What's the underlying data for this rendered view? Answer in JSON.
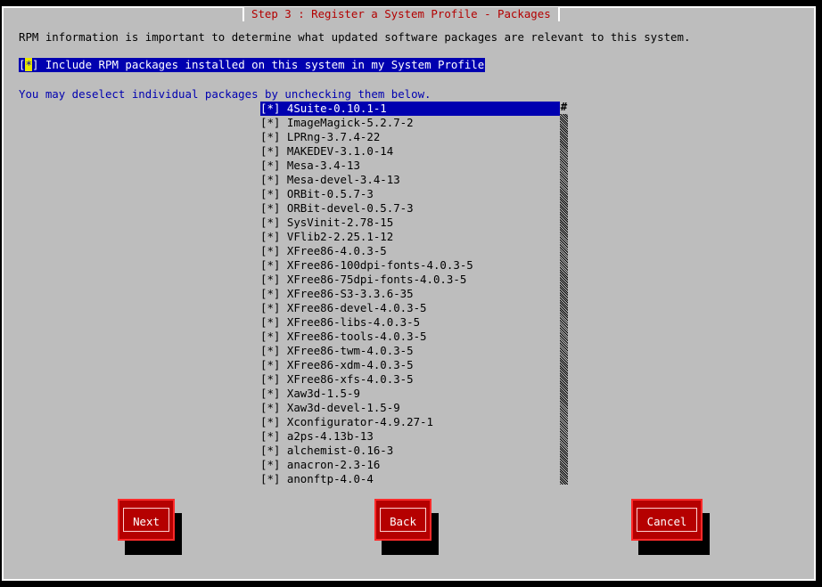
{
  "title": "Step 3 : Register a System Profile - Packages",
  "intro": "RPM information is important to determine what updated software packages are relevant to this system.",
  "include_checkbox": {
    "mark": "*",
    "label": "Include RPM packages installed on this system in my System Profile"
  },
  "hint": "You may deselect individual packages by unchecking them below.",
  "scrollbar_thumb": "#",
  "packages": [
    {
      "check": "[*]",
      "name": "4Suite-0.10.1-1"
    },
    {
      "check": "[*]",
      "name": "ImageMagick-5.2.7-2"
    },
    {
      "check": "[*]",
      "name": "LPRng-3.7.4-22"
    },
    {
      "check": "[*]",
      "name": "MAKEDEV-3.1.0-14"
    },
    {
      "check": "[*]",
      "name": "Mesa-3.4-13"
    },
    {
      "check": "[*]",
      "name": "Mesa-devel-3.4-13"
    },
    {
      "check": "[*]",
      "name": "ORBit-0.5.7-3"
    },
    {
      "check": "[*]",
      "name": "ORBit-devel-0.5.7-3"
    },
    {
      "check": "[*]",
      "name": "SysVinit-2.78-15"
    },
    {
      "check": "[*]",
      "name": "VFlib2-2.25.1-12"
    },
    {
      "check": "[*]",
      "name": "XFree86-4.0.3-5"
    },
    {
      "check": "[*]",
      "name": "XFree86-100dpi-fonts-4.0.3-5"
    },
    {
      "check": "[*]",
      "name": "XFree86-75dpi-fonts-4.0.3-5"
    },
    {
      "check": "[*]",
      "name": "XFree86-S3-3.3.6-35"
    },
    {
      "check": "[*]",
      "name": "XFree86-devel-4.0.3-5"
    },
    {
      "check": "[*]",
      "name": "XFree86-libs-4.0.3-5"
    },
    {
      "check": "[*]",
      "name": "XFree86-tools-4.0.3-5"
    },
    {
      "check": "[*]",
      "name": "XFree86-twm-4.0.3-5"
    },
    {
      "check": "[*]",
      "name": "XFree86-xdm-4.0.3-5"
    },
    {
      "check": "[*]",
      "name": "XFree86-xfs-4.0.3-5"
    },
    {
      "check": "[*]",
      "name": "Xaw3d-1.5-9"
    },
    {
      "check": "[*]",
      "name": "Xaw3d-devel-1.5-9"
    },
    {
      "check": "[*]",
      "name": "Xconfigurator-4.9.27-1"
    },
    {
      "check": "[*]",
      "name": "a2ps-4.13b-13"
    },
    {
      "check": "[*]",
      "name": "alchemist-0.16-3"
    },
    {
      "check": "[*]",
      "name": "anacron-2.3-16"
    },
    {
      "check": "[*]",
      "name": "anonftp-4.0-4"
    }
  ],
  "buttons": {
    "next": "Next",
    "back": "Back",
    "cancel": "Cancel"
  },
  "colors": {
    "background": "#bdbdbd",
    "selection": "#0000b0",
    "button": "#b50000",
    "title": "#b30000"
  }
}
